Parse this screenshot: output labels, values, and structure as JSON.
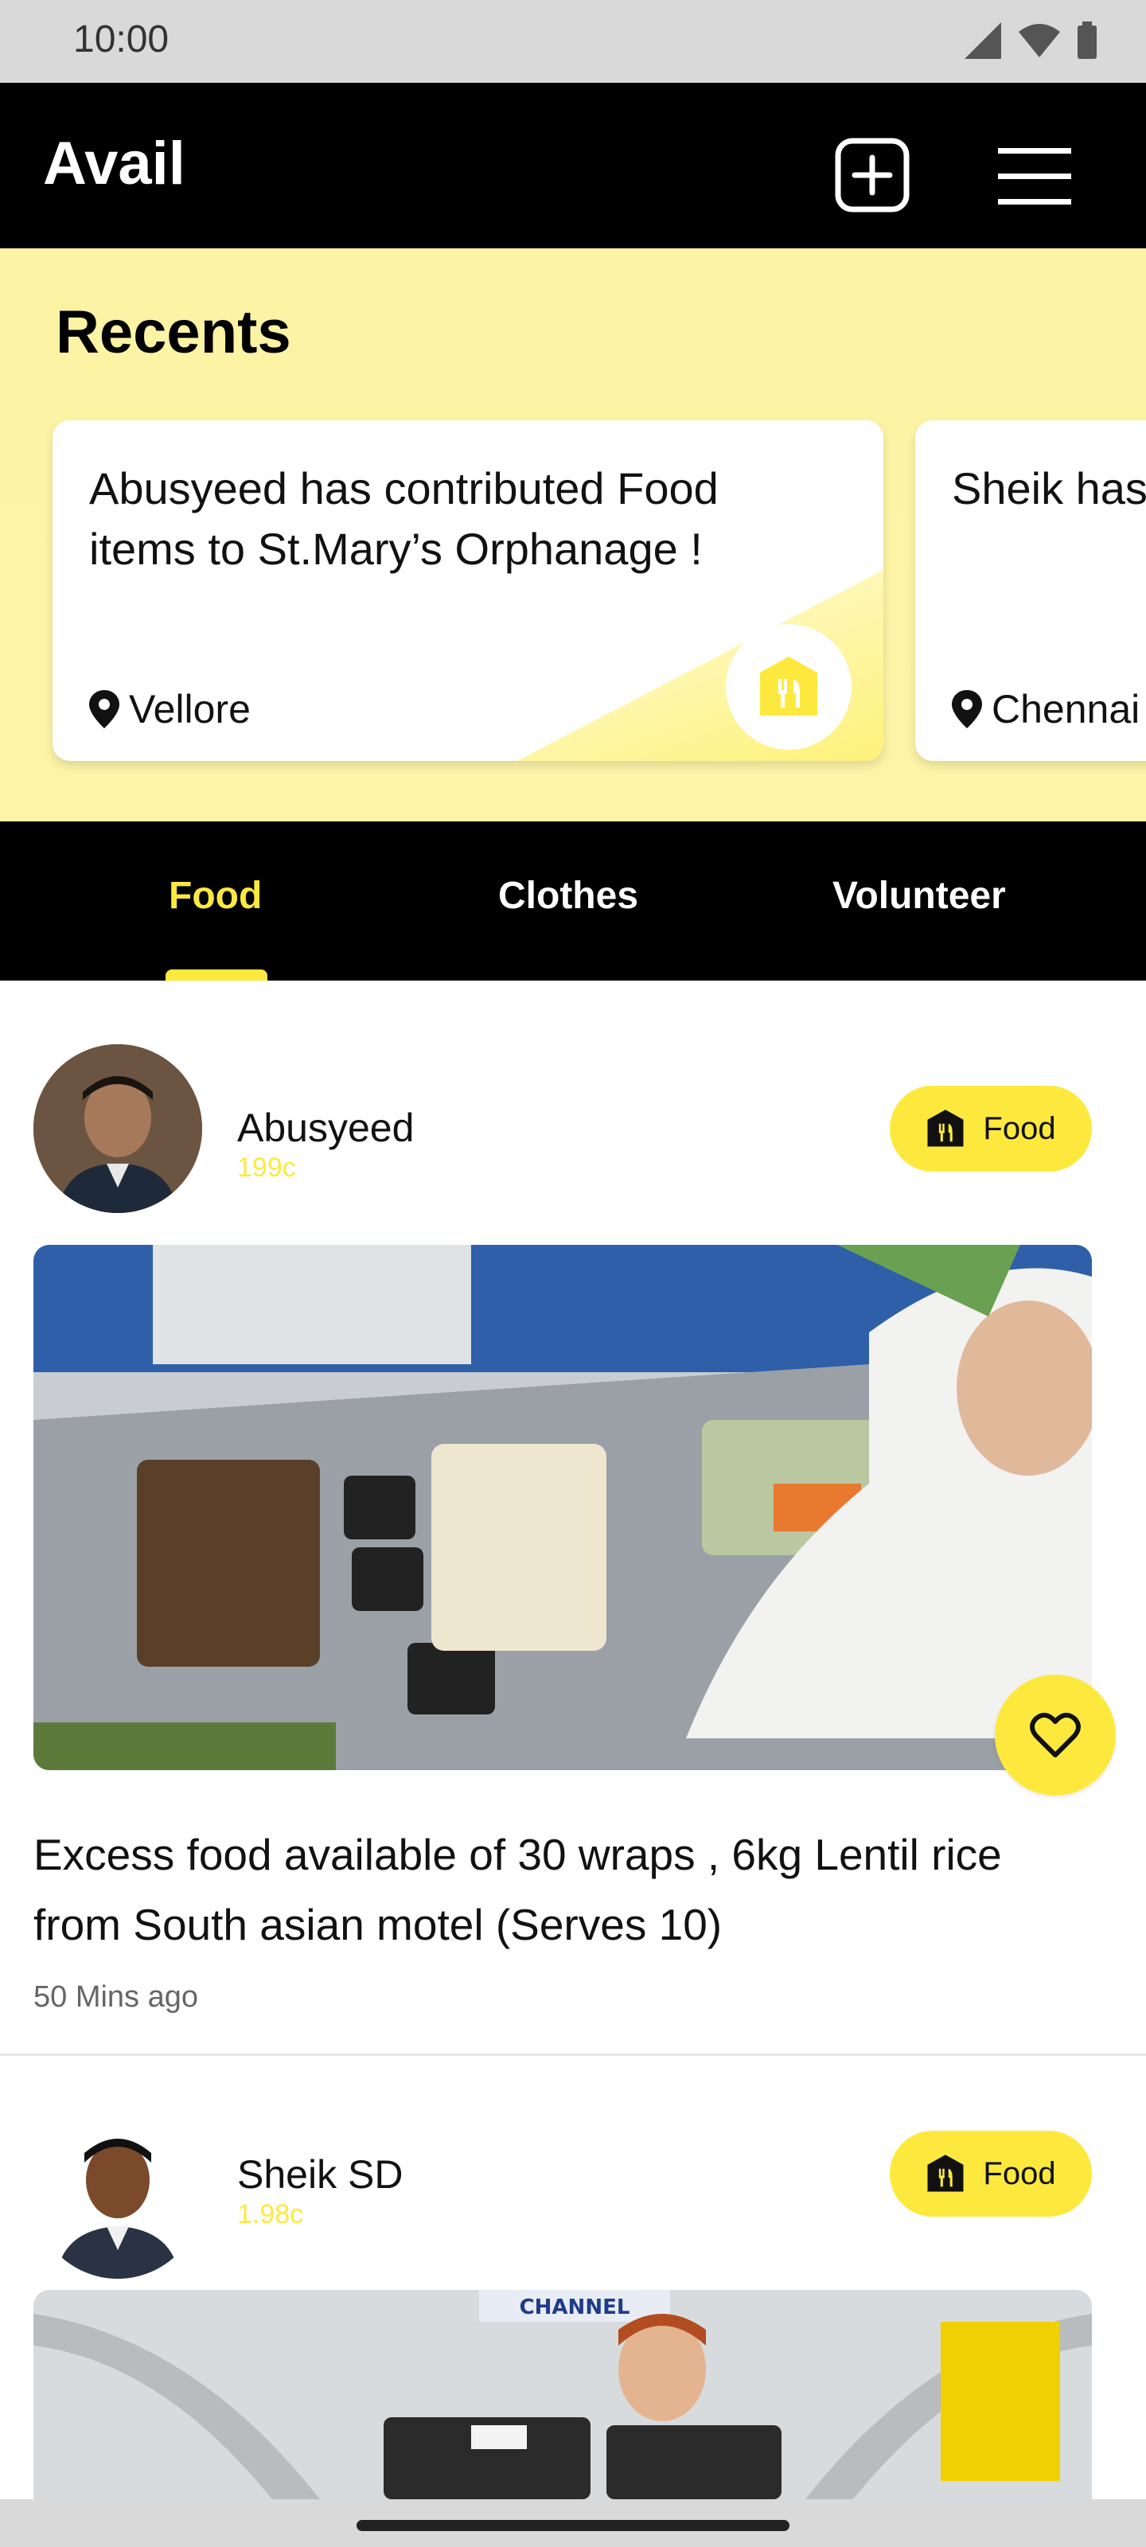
{
  "status_bar": {
    "time": "10:00"
  },
  "app_bar": {
    "title": "Avail"
  },
  "recents": {
    "title": "Recents",
    "cards": [
      {
        "text": "Abusyeed has contributed Food items to St.Mary’s Orphanage !",
        "location": "Vellore"
      },
      {
        "text": "Sheik has delivery t",
        "location": "Chennai"
      }
    ]
  },
  "tabs": [
    {
      "label": "Food",
      "active": true
    },
    {
      "label": "Clothes",
      "active": false
    },
    {
      "label": "Volunteer",
      "active": false
    }
  ],
  "posts": [
    {
      "name": "Abusyeed",
      "points": "199c",
      "category": "Food",
      "description": "Excess food available of 30 wraps , 6kg Lentil rice from South asian motel (Serves 10)",
      "time": "50 Mins ago"
    },
    {
      "name": "Sheik SD",
      "points": "1.98c",
      "category": "Food",
      "image_sign": "CHANNEL"
    }
  ],
  "colors": {
    "accent": "#fde93e",
    "recents_bg": "#fdf3a4",
    "bar": "#000000"
  }
}
